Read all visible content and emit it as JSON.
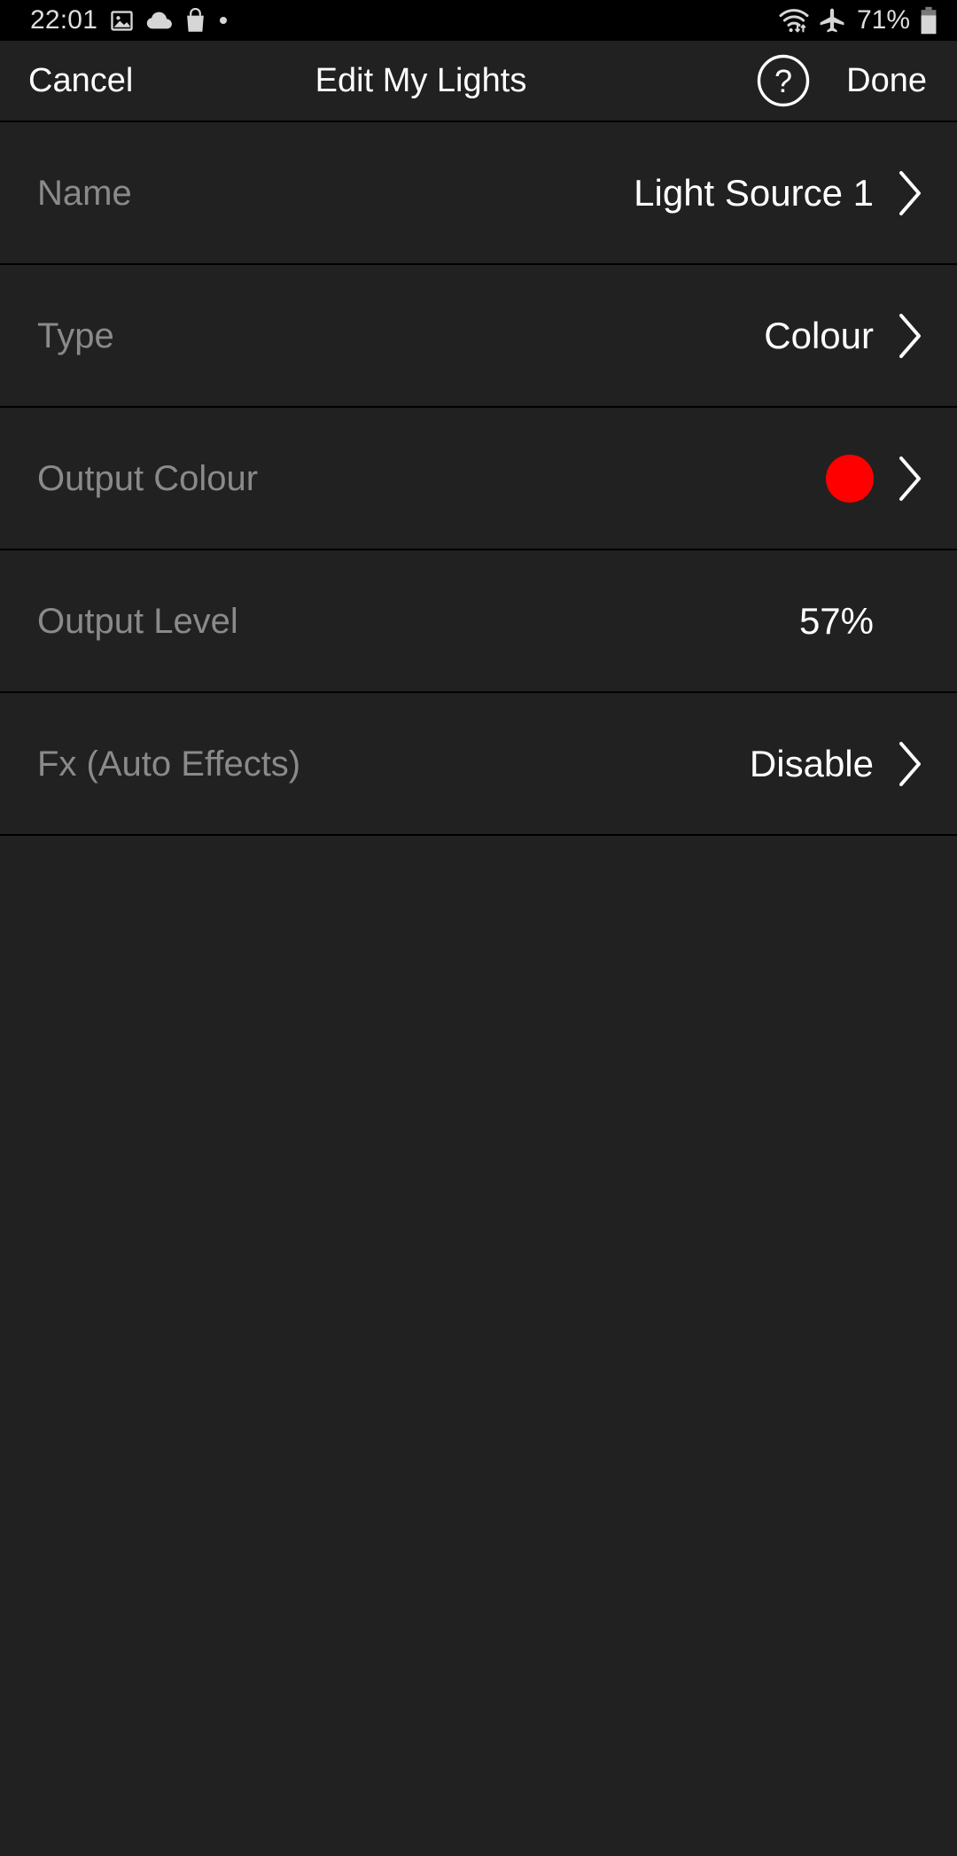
{
  "status_bar": {
    "time": "22:01",
    "left_icons": [
      "image-icon",
      "cloud-icon",
      "shopping-bag-icon",
      "dot-icon"
    ],
    "right_icons": [
      "wifi-icon",
      "airplane-mode-icon"
    ],
    "battery_percent": "71%",
    "battery_icon": "battery-icon"
  },
  "nav": {
    "cancel_label": "Cancel",
    "title": "Edit My Lights",
    "help_icon": "help-circle-icon",
    "done_label": "Done"
  },
  "rows": [
    {
      "label": "Name",
      "value": "Light Source 1",
      "chevron": true,
      "swatch": null,
      "name": "row-name"
    },
    {
      "label": "Type",
      "value": "Colour",
      "chevron": true,
      "swatch": null,
      "name": "row-type"
    },
    {
      "label": "Output Colour",
      "value": "",
      "chevron": true,
      "swatch": "#FF0000",
      "name": "row-output-colour"
    },
    {
      "label": "Output Level",
      "value": "57%",
      "chevron": false,
      "swatch": null,
      "name": "row-output-level"
    },
    {
      "label": "Fx (Auto Effects)",
      "value": "Disable",
      "chevron": true,
      "swatch": null,
      "name": "row-fx-auto-effects"
    }
  ],
  "colors": {
    "background": "#212121",
    "status_bar_bg": "#000000",
    "divider": "#000000",
    "label_text": "#8A8A8A",
    "value_text": "#FFFFFF",
    "accent_swatch": "#FF0000"
  }
}
